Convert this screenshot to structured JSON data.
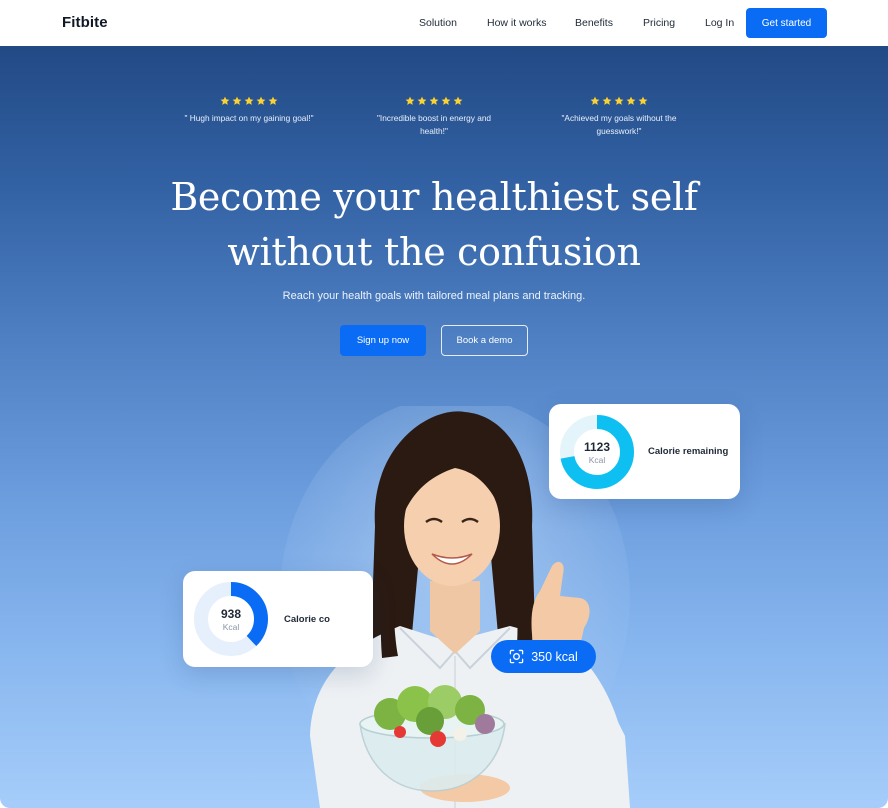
{
  "header": {
    "logo": "Fitbite",
    "nav": [
      "Solution",
      "How it works",
      "Benefits",
      "Pricing"
    ],
    "login": "Log In",
    "cta": "Get started"
  },
  "reviews": [
    {
      "stars": 5,
      "text": "\" Hugh impact on my gaining goal!\""
    },
    {
      "stars": 5,
      "text": "\"Incredible boost in energy and health!\""
    },
    {
      "stars": 5,
      "text": "\"Achieved my goals without the guesswork!\""
    }
  ],
  "hero": {
    "headline_line1": "Become your healthiest self",
    "headline_line2": "without the confusion",
    "subheadline": "Reach your health goals with tailored meal plans and tracking.",
    "primary_cta": "Sign up now",
    "secondary_cta": "Book a demo"
  },
  "cards": {
    "remaining": {
      "value": "1123",
      "unit": "Kcal",
      "label": "Calorie remaining",
      "progress": 0.72,
      "color": "#0ec0f2"
    },
    "consumed": {
      "value": "938",
      "unit": "Kcal",
      "label": "Calorie co",
      "progress": 0.38,
      "color": "#0a6cf5"
    }
  },
  "kcal_badge": {
    "icon": "scan-icon",
    "label": "350 kcal"
  },
  "colors": {
    "primary": "#0a6cf5",
    "star": "#fbd233",
    "hero_top": "#224a85",
    "hero_bottom": "#a6cdfa"
  }
}
